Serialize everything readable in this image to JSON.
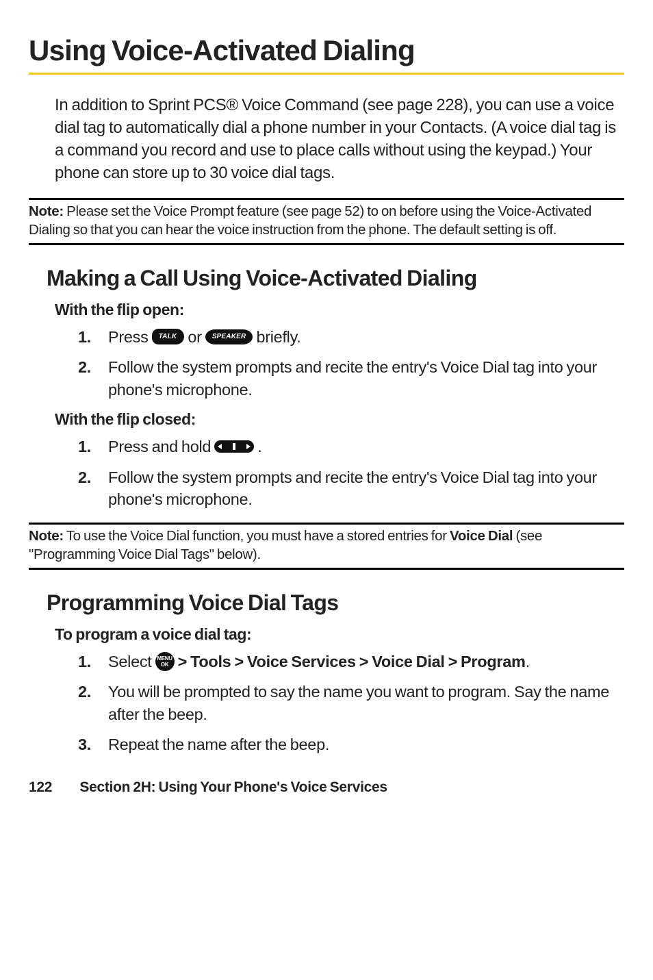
{
  "title": "Using Voice-Activated Dialing",
  "intro": "In addition to Sprint PCS® Voice Command (see page 228), you can use a voice dial tag to automatically dial a phone number in your Contacts. (A voice dial tag is a command you record and use to place calls without using the keypad.) Your phone can store up to 30 voice dial tags.",
  "note1": {
    "label": "Note:",
    "text": " Please set the Voice Prompt feature (see page 52) to on before using the Voice-Activated Dialing so that you can hear the voice instruction from the phone. The default setting is off."
  },
  "section1": {
    "heading": "Making a Call Using Voice-Activated Dialing",
    "sub1": "With the flip open:",
    "open_steps": [
      {
        "num": "1.",
        "pre": "Press ",
        "mid": " or ",
        "post": " briefly."
      },
      {
        "num": "2.",
        "text": "Follow the system prompts and recite the entry's Voice Dial tag into your phone's microphone."
      }
    ],
    "sub2": "With the flip closed:",
    "closed_steps": [
      {
        "num": "1.",
        "pre": "Press and hold ",
        "post": "."
      },
      {
        "num": "2.",
        "text": "Follow the system prompts and recite the entry's Voice Dial tag into your phone's microphone."
      }
    ]
  },
  "note2": {
    "label": "Note:",
    "pre": " To use the Voice Dial function, you must have a stored entries for ",
    "bold": "Voice Dial",
    "post": " (see \"Programming Voice Dial Tags\" below)."
  },
  "section2": {
    "heading": "Programming Voice Dial Tags",
    "sub": "To program a voice dial tag:",
    "steps": [
      {
        "num": "1.",
        "pre": "Select ",
        "path": " > Tools > Voice Services > Voice Dial > Program",
        "post": "."
      },
      {
        "num": "2.",
        "text": "You will be prompted to say the name you want to program. Say the name after the beep."
      },
      {
        "num": "3.",
        "text": "Repeat the name after the beep."
      }
    ]
  },
  "icons": {
    "talk": "TALK",
    "speaker": "SPEAKER",
    "menu_top": "MENU",
    "menu_bot": "OK"
  },
  "footer": {
    "page": "122",
    "section": "Section 2H: Using Your Phone's Voice Services"
  }
}
